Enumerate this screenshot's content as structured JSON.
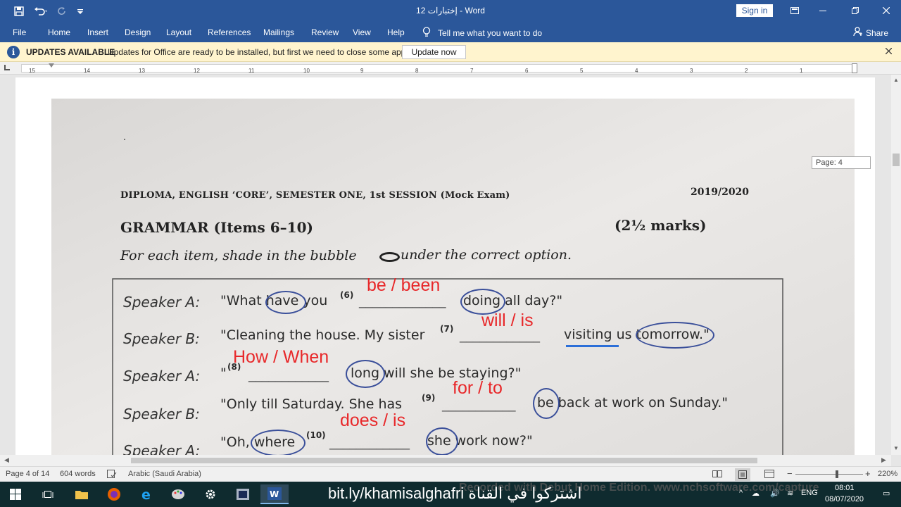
{
  "titlebar": {
    "title": "إختبارات 12  -  Word",
    "sign_in": "Sign in",
    "save_icon": "save-icon",
    "undo_icon": "undo-icon"
  },
  "ribbon": {
    "tabs": [
      "File",
      "Home",
      "Insert",
      "Design",
      "Layout",
      "References",
      "Mailings",
      "Review",
      "View",
      "Help"
    ],
    "tell_me": "Tell me what you want to do",
    "share": "Share"
  },
  "message_bar": {
    "title": "UPDATES AVAILABLE",
    "text": "Updates for Office are ready to be installed, but first we need to close some apps.",
    "button": "Update now"
  },
  "ruler": {
    "numbers": [
      "15",
      "14",
      "13",
      "12",
      "11",
      "10",
      "9",
      "8",
      "7",
      "6",
      "5",
      "4",
      "3",
      "2",
      "1"
    ]
  },
  "page_tooltip": "Page: 4",
  "exam": {
    "header_left": "DIPLOMA, ENGLISH ‘CORE’, SEMESTER ONE, 1st SESSION  (Mock Exam)",
    "header_right": "2019/2020",
    "section": "GRAMMAR   (Items 6–10)",
    "marks": "(2½ marks)",
    "instruction_a": "For each item, shade in the bubble",
    "instruction_b": "under the correct option.",
    "lines": [
      {
        "speaker": "Speaker A:",
        "before": "\"What have you",
        "num": "(6)",
        "blank": "_____________",
        "after": "doing all day?\"",
        "answers": "be / been"
      },
      {
        "speaker": "Speaker B:",
        "before": "\"Cleaning the house. My sister",
        "num": "(7)",
        "blank": "____________",
        "after": "visiting us tomorrow.\"",
        "answers": "will / is"
      },
      {
        "speaker": "Speaker A:",
        "before": "\"",
        "num": "(8)",
        "blank": "____________",
        "after": "long will she be staying?\"",
        "answers": "How / When"
      },
      {
        "speaker": "Speaker B:",
        "before": "\"Only till Saturday. She has",
        "num": "(9)",
        "blank": "___________",
        "after": "be back at work on Sunday.\"",
        "answers": "for / to"
      },
      {
        "speaker": "Speaker A:",
        "before": "\"Oh, where",
        "num": "(10)",
        "blank": "____________",
        "after": "she work now?\"",
        "answers": "does / is"
      }
    ]
  },
  "statusbar": {
    "page": "Page 4 of 14",
    "words": "604 words",
    "language": "Arabic (Saudi Arabia)",
    "zoom": "220%"
  },
  "taskbar": {
    "promo": "bit.ly/khamisalghafri اشتركوا في القناة",
    "watermark": "Recorded with Debut Home Edition. www.nchsoftware.com/capture",
    "lang": "ENG",
    "time": "08:01",
    "date": "08/07/2020"
  }
}
